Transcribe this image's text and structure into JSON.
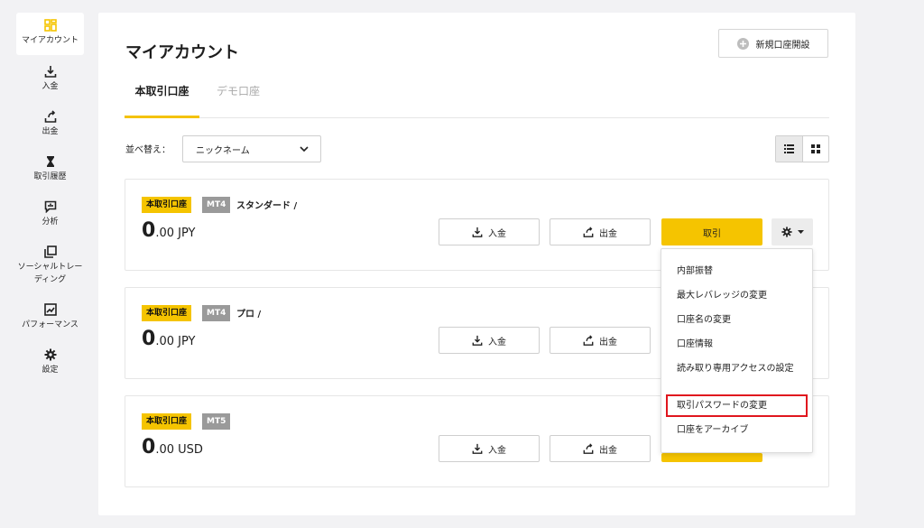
{
  "sidebar": {
    "items": [
      {
        "label": "マイアカウント",
        "icon": "dashboard-icon"
      },
      {
        "label": "入金",
        "icon": "download-icon"
      },
      {
        "label": "出金",
        "icon": "upload-icon"
      },
      {
        "label": "取引履歴",
        "icon": "hourglass-icon"
      },
      {
        "label": "分析",
        "icon": "chart-bubble-icon"
      },
      {
        "label": "ソーシャルトレーディング",
        "icon": "copy-icon"
      },
      {
        "label": "パフォーマンス",
        "icon": "performance-icon"
      },
      {
        "label": "設定",
        "icon": "gear-icon"
      }
    ]
  },
  "header": {
    "title": "マイアカウント",
    "new_account_label": "新規口座開設"
  },
  "tabs": [
    {
      "label": "本取引口座"
    },
    {
      "label": "デモ口座"
    }
  ],
  "sort": {
    "label": "並べ替え：",
    "selected": "ニックネーム"
  },
  "accounts": [
    {
      "type": "本取引口座",
      "platform": "MT4",
      "name": "スタンダード /",
      "balance_int": "0",
      "balance_rest": ".00 JPY"
    },
    {
      "type": "本取引口座",
      "platform": "MT4",
      "name": "プロ /",
      "balance_int": "0",
      "balance_rest": ".00 JPY"
    },
    {
      "type": "本取引口座",
      "platform": "MT5",
      "name": "",
      "balance_int": "0",
      "balance_rest": ".00 USD"
    }
  ],
  "actions": {
    "deposit": "入金",
    "withdraw": "出金",
    "trade": "取引"
  },
  "menu": {
    "items": [
      "内部振替",
      "最大レバレッジの変更",
      "口座名の変更",
      "口座情報",
      "読み取り専用アクセスの設定",
      "取引パスワードの変更",
      "口座をアーカイブ"
    ],
    "highlighted_index": 5
  },
  "colors": {
    "accent": "#f5c400",
    "highlight_border": "#e0161e",
    "platform_badge": "#9a9a9a"
  }
}
